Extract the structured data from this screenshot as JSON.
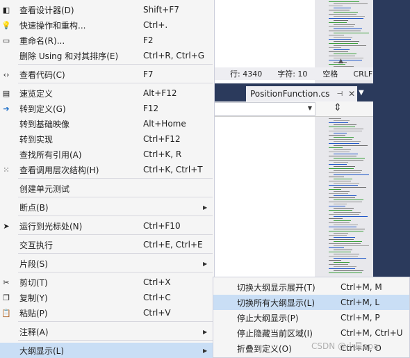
{
  "status_bar": {
    "line": "行: 4340",
    "char": "字符: 10",
    "spaces": "空格",
    "eol": "CRLF"
  },
  "document_tab": {
    "filename": "PositionFunction.cs",
    "pin_icon": "pin-icon",
    "close_icon": "close-icon"
  },
  "split_icon": "split-editor-icon",
  "context_menu": {
    "items": [
      {
        "label": "查看设计器(D)",
        "shortcut": "Shift+F7",
        "icon": "view-designer-icon"
      },
      {
        "label": "快速操作和重构...",
        "shortcut": "Ctrl+.",
        "icon": "lightbulb-icon"
      },
      {
        "label": "重命名(R)...",
        "shortcut": "F2",
        "icon": "rename-icon"
      },
      {
        "label": "删除 Using 和对其排序(E)",
        "shortcut": "Ctrl+R, Ctrl+G",
        "icon": ""
      },
      {
        "label": "查看代码(C)",
        "shortcut": "F7",
        "icon": "code-icon"
      },
      {
        "label": "速览定义",
        "shortcut": "Alt+F12",
        "icon": "peek-definition-icon"
      },
      {
        "label": "转到定义(G)",
        "shortcut": "F12",
        "icon": "go-to-definition-icon"
      },
      {
        "label": "转到基础映像",
        "shortcut": "Alt+Home",
        "icon": ""
      },
      {
        "label": "转到实现",
        "shortcut": "Ctrl+F12",
        "icon": ""
      },
      {
        "label": "查找所有引用(A)",
        "shortcut": "Ctrl+K, R",
        "icon": ""
      },
      {
        "label": "查看调用层次结构(H)",
        "shortcut": "Ctrl+K, Ctrl+T",
        "icon": "call-hierarchy-icon"
      },
      {
        "label": "创建单元测试",
        "shortcut": "",
        "icon": ""
      },
      {
        "label": "断点(B)",
        "shortcut": "",
        "icon": "",
        "submenu": true
      },
      {
        "label": "运行到光标处(N)",
        "shortcut": "Ctrl+F10",
        "icon": "run-to-cursor-icon"
      },
      {
        "label": "交互执行",
        "shortcut": "Ctrl+E, Ctrl+E",
        "icon": ""
      },
      {
        "label": "片段(S)",
        "shortcut": "",
        "icon": "",
        "submenu": true
      },
      {
        "label": "剪切(T)",
        "shortcut": "Ctrl+X",
        "icon": "cut-icon"
      },
      {
        "label": "复制(Y)",
        "shortcut": "Ctrl+C",
        "icon": "copy-icon"
      },
      {
        "label": "粘贴(P)",
        "shortcut": "Ctrl+V",
        "icon": "paste-icon"
      },
      {
        "label": "注释(A)",
        "shortcut": "",
        "icon": "",
        "submenu": true
      },
      {
        "label": "大纲显示(L)",
        "shortcut": "",
        "icon": "",
        "submenu": true,
        "selected": true
      }
    ]
  },
  "outlining_submenu": {
    "items": [
      {
        "label": "切换大纲显示展开(T)",
        "shortcut": "Ctrl+M, M"
      },
      {
        "label": "切换所有大纲显示(L)",
        "shortcut": "Ctrl+M, L",
        "selected": true
      },
      {
        "label": "停止大纲显示(P)",
        "shortcut": "Ctrl+M, P"
      },
      {
        "label": "停止隐藏当前区域(I)",
        "shortcut": "Ctrl+M, Ctrl+U"
      },
      {
        "label": "折叠到定义(O)",
        "shortcut": "Ctrl+M, O"
      }
    ]
  },
  "watermark": "CSDN @小星apa",
  "colors": {
    "menu_bg": "#f5f5f5",
    "highlight": "#c9def5",
    "vs_dark_blue": "#2b3a5c",
    "separator": "#d7d7de"
  }
}
